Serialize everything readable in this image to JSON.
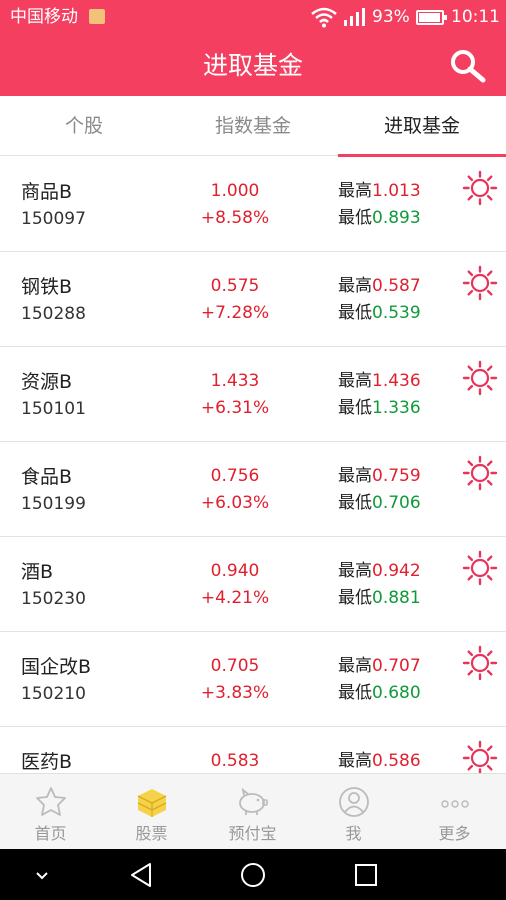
{
  "status_bar": {
    "carrier": "中国移动",
    "battery": "93%",
    "time": "10:11"
  },
  "header": {
    "title": "进取基金"
  },
  "tabs": [
    {
      "label": "个股",
      "active": false
    },
    {
      "label": "指数基金",
      "active": false
    },
    {
      "label": "进取基金",
      "active": true
    }
  ],
  "labels": {
    "high": "最高",
    "low": "最低"
  },
  "funds": [
    {
      "name": "商品B",
      "code": "150097",
      "price": "1.000",
      "change": "+8.58%",
      "high": "1.013",
      "low": "0.893"
    },
    {
      "name": "钢铁B",
      "code": "150288",
      "price": "0.575",
      "change": "+7.28%",
      "high": "0.587",
      "low": "0.539"
    },
    {
      "name": "资源B",
      "code": "150101",
      "price": "1.433",
      "change": "+6.31%",
      "high": "1.436",
      "low": "1.336"
    },
    {
      "name": "食品B",
      "code": "150199",
      "price": "0.756",
      "change": "+6.03%",
      "high": "0.759",
      "low": "0.706"
    },
    {
      "name": "酒B",
      "code": "150230",
      "price": "0.940",
      "change": "+4.21%",
      "high": "0.942",
      "low": "0.881"
    },
    {
      "name": "国企改B",
      "code": "150210",
      "price": "0.705",
      "change": "+3.83%",
      "high": "0.707",
      "low": "0.680"
    },
    {
      "name": "医药B",
      "code": "",
      "price": "0.583",
      "change": "",
      "high": "0.586",
      "low": ""
    }
  ],
  "bottom_nav": [
    {
      "label": "首页",
      "icon": "star-icon"
    },
    {
      "label": "股票",
      "icon": "stack-icon"
    },
    {
      "label": "预付宝",
      "icon": "piggy-bank-icon"
    },
    {
      "label": "我",
      "icon": "user-icon"
    },
    {
      "label": "更多",
      "icon": "more-icon"
    }
  ],
  "colors": {
    "brand": "#f43f60",
    "up": "#e0202f",
    "down": "#0f9a3a"
  }
}
